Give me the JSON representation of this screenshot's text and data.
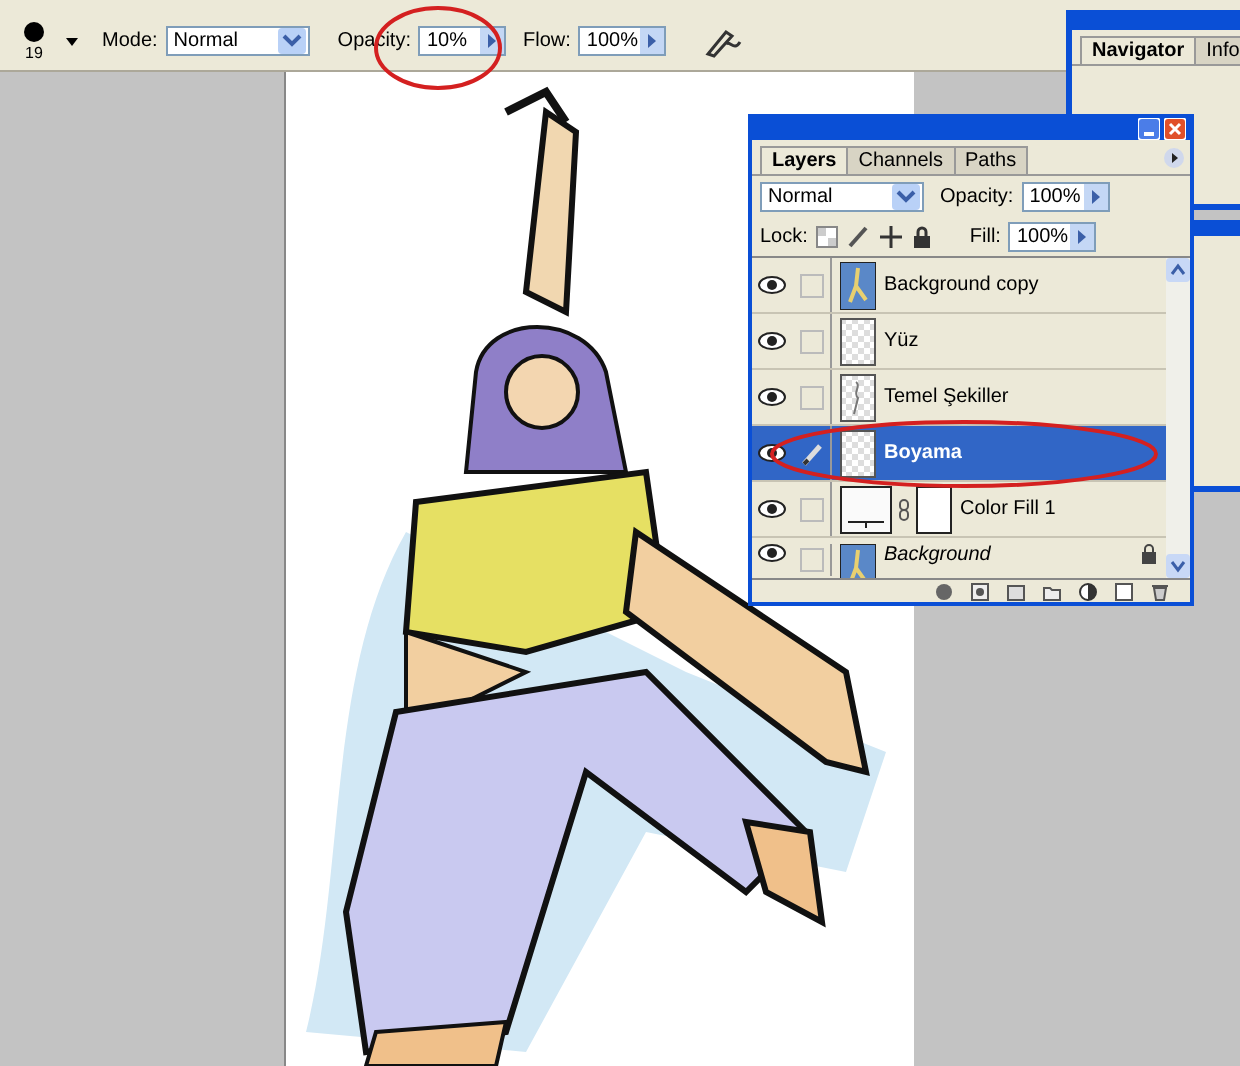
{
  "toolbar": {
    "brush_size": "19",
    "mode_label": "Mode:",
    "mode": "Normal",
    "opacity_label": "Opacity:",
    "opacity": "10%",
    "flow_label": "Flow:",
    "flow": "100%"
  },
  "navigator": {
    "tabs": [
      {
        "label": "Navigator",
        "selected": true
      },
      {
        "label": "Info",
        "selected": false
      }
    ]
  },
  "layers_panel": {
    "tabs": [
      {
        "label": "Layers",
        "selected": true
      },
      {
        "label": "Channels",
        "selected": false
      },
      {
        "label": "Paths",
        "selected": false
      }
    ],
    "blend_mode": "Normal",
    "opacity_label": "Opacity:",
    "opacity": "100%",
    "lock_label": "Lock:",
    "fill_label": "Fill:",
    "fill": "100%",
    "layers": [
      {
        "name": "Background copy",
        "visible": true,
        "selected": false
      },
      {
        "name": "Yüz",
        "kind": "transparent",
        "visible": true,
        "selected": false
      },
      {
        "name": "Temel Şekiller",
        "kind": "sketch",
        "visible": true,
        "selected": false
      },
      {
        "name": "Boyama",
        "kind": "transparent",
        "visible": true,
        "selected": true
      },
      {
        "name": "Color Fill 1",
        "kind": "fill",
        "visible": true,
        "selected": false
      },
      {
        "name": "Background",
        "kind": "background",
        "visible": true,
        "selected": false
      }
    ]
  }
}
